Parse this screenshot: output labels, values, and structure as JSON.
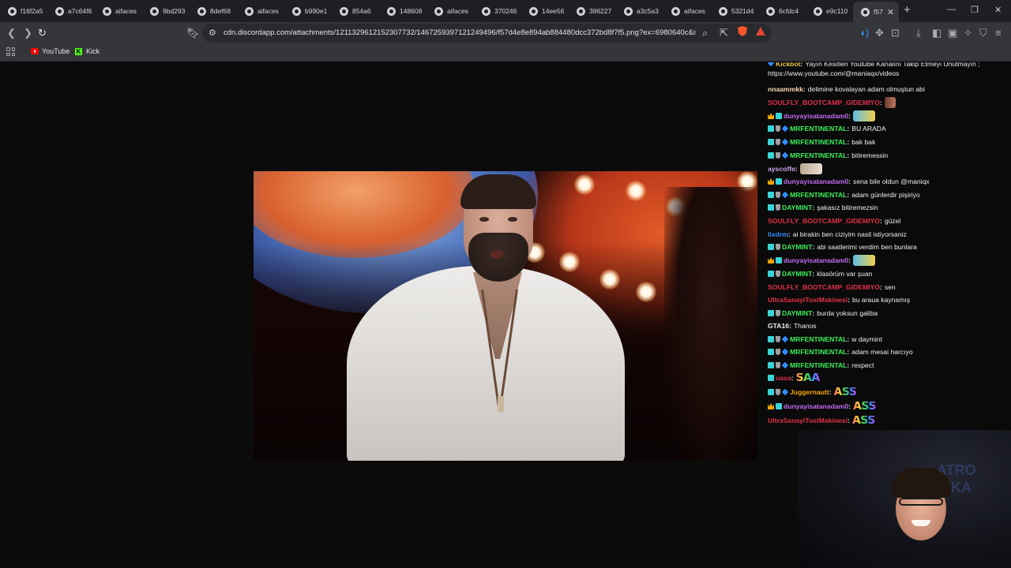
{
  "browser": {
    "tabs": [
      {
        "label": "f16f2a5"
      },
      {
        "label": "a7c64f6"
      },
      {
        "label": "aifaces"
      },
      {
        "label": "9bd293"
      },
      {
        "label": "8def68"
      },
      {
        "label": "aifaces"
      },
      {
        "label": "b990e1"
      },
      {
        "label": "854a6"
      },
      {
        "label": "148608"
      },
      {
        "label": "aifaces"
      },
      {
        "label": "370246"
      },
      {
        "label": "14ee56"
      },
      {
        "label": "386227"
      },
      {
        "label": "a3c5a3"
      },
      {
        "label": "aifaces"
      },
      {
        "label": "5321d4"
      },
      {
        "label": "6cfdc4"
      },
      {
        "label": "e9c110"
      },
      {
        "label": "f57",
        "active": true
      }
    ],
    "url": "cdn.discordapp.com/attachments/1211329612152307732/1467259397121249496/f57d4e8e894ab884480dcc372bd8f7f5.png?ex=6980640c&is...",
    "bookmarks": [
      {
        "label": "YouTube",
        "icon": "youtube-icon"
      },
      {
        "label": "Kick",
        "icon": "kick-icon"
      }
    ]
  },
  "chat": {
    "messages": [
      {
        "user": "Kickbot",
        "color": "#e8c84a",
        "text": "Yayın Kesitleri Youtube Kanalını Takip Etmeyi Unutmayın ; https://www.youtube.com/@maniaqx/videos",
        "badges": [
          "gem"
        ],
        "wrap": true
      },
      {
        "user": "nnaammkk",
        "color": "#f5d7b0",
        "text": "delimine kovalayan adam olmuştun abi",
        "badges": []
      },
      {
        "user": "SOULFLY_BOOTCAMP_GIDEMIYO",
        "color": "#e1314b",
        "text": "",
        "badges": [],
        "emote": "pic"
      },
      {
        "user": "dunyayisatanadam0",
        "color": "#c46cf2",
        "text": "",
        "badges": [
          "crown",
          "sub"
        ],
        "emote": "cat"
      },
      {
        "user": "MRFENTINENTAL",
        "color": "#3df05a",
        "text": "BU ARADA",
        "badges": [
          "sub",
          "shield",
          "gem"
        ]
      },
      {
        "user": "MRFENTINENTAL",
        "color": "#3df05a",
        "text": "bak bak",
        "badges": [
          "sub",
          "shield",
          "gem"
        ]
      },
      {
        "user": "MRFENTINENTAL",
        "color": "#3df05a",
        "text": "bitiremessin",
        "badges": [
          "sub",
          "shield",
          "gem"
        ]
      },
      {
        "user": "ayscoffe",
        "color": "#cfa0f0",
        "text": "",
        "badges": [],
        "emote": "doge"
      },
      {
        "user": "dunyayisatanadam0",
        "color": "#c46cf2",
        "text": "sena bile oldun @maniqx",
        "badges": [
          "crown",
          "sub"
        ]
      },
      {
        "user": "MRFENTINENTAL",
        "color": "#3df05a",
        "text": "adam günlerdir pişiriyo",
        "badges": [
          "sub",
          "shield",
          "gem"
        ]
      },
      {
        "user": "DAYMINT",
        "color": "#3df05a",
        "text": "şakasız bitiremezsin",
        "badges": [
          "sub",
          "shield"
        ]
      },
      {
        "user": "SOULFLY_BOOTCAMP_GIDEMIYO",
        "color": "#e1314b",
        "text": "güzel",
        "badges": []
      },
      {
        "user": "lixdrm",
        "color": "#3a8dff",
        "text": "ai birakin ben ciziyim nasil istiyorsaniz",
        "badges": []
      },
      {
        "user": "DAYMINT",
        "color": "#3df05a",
        "text": "abi saatlerimi verdim ben bunlara",
        "badges": [
          "sub",
          "shield"
        ]
      },
      {
        "user": "dunyayisatanadam0",
        "color": "#c46cf2",
        "text": "",
        "badges": [
          "crown",
          "sub"
        ],
        "emote": "cat"
      },
      {
        "user": "DAYMINT",
        "color": "#3df05a",
        "text": "klasörüm var şuan",
        "badges": [
          "sub",
          "shield"
        ]
      },
      {
        "user": "SOULFLY_BOOTCAMP_GIDEMIYO",
        "color": "#e1314b",
        "text": "sen",
        "badges": []
      },
      {
        "user": "UltraSanayiTostMakinesi",
        "color": "#e1314b",
        "text": "bu araua kaynamış",
        "badges": []
      },
      {
        "user": "DAYMINT",
        "color": "#3df05a",
        "text": "burda yoksun galiba",
        "badges": [
          "sub",
          "shield"
        ]
      },
      {
        "user": "GTA16",
        "color": "#efeff1",
        "text": "Thanos",
        "badges": []
      },
      {
        "user": "MRFENTINENTAL",
        "color": "#3df05a",
        "text": "w daymint",
        "badges": [
          "sub",
          "shield",
          "gem"
        ]
      },
      {
        "user": "MRFENTINENTAL",
        "color": "#3df05a",
        "text": "adam mesai harcıyo",
        "badges": [
          "sub",
          "shield",
          "gem"
        ]
      },
      {
        "user": "MRFENTINENTAL",
        "color": "#3df05a",
        "text": "respect",
        "badges": [
          "sub",
          "shield",
          "gem"
        ]
      },
      {
        "user": "uasa",
        "color": "#e1314b",
        "text": "",
        "badges": [
          "sub"
        ],
        "emoteText": "SAA"
      },
      {
        "user": "Juggernautt",
        "color": "#f6a700",
        "text": "",
        "badges": [
          "sub",
          "shield",
          "gem"
        ],
        "emoteText": "ASS"
      },
      {
        "user": "dunyayisatanadam0",
        "color": "#c46cf2",
        "text": "",
        "badges": [
          "crown",
          "sub"
        ],
        "emoteText": "ASS"
      },
      {
        "user": "UltraSanayiTostMakinesi",
        "color": "#e1314b",
        "text": "",
        "badges": [],
        "emoteText": "ASS"
      }
    ]
  },
  "webcam": {
    "sign_text": "ATRO RIKA"
  }
}
